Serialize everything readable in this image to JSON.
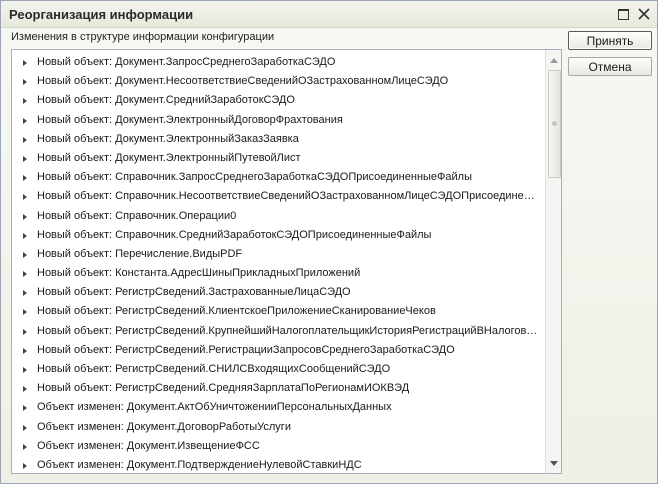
{
  "window": {
    "title": "Реорганизация информации",
    "controls": {
      "maximize_icon": "maximize-icon",
      "close_icon": "close-icon"
    }
  },
  "subtitle": "Изменения в структуре информации конфигурации",
  "buttons": {
    "accept_label": "Принять",
    "cancel_label": "Отмена"
  },
  "items": [
    "Новый объект: Документ.ЗапросСреднегоЗаработкаСЭДО",
    "Новый объект: Документ.НесоответствиеСведенийОЗастрахованномЛицеСЭДО",
    "Новый объект: Документ.СреднийЗаработокСЭДО",
    "Новый объект: Документ.ЭлектронныйДоговорФрахтования",
    "Новый объект: Документ.ЭлектронныйЗаказЗаявка",
    "Новый объект: Документ.ЭлектронныйПутевойЛист",
    "Новый объект: Справочник.ЗапросСреднегоЗаработкаСЭДОПрисоединенныеФайлы",
    "Новый объект: Справочник.НесоответствиеСведенийОЗастрахованномЛицеСЭДОПрисоединенныеФайлы",
    "Новый объект: Справочник.Операции0",
    "Новый объект: Справочник.СреднийЗаработокСЭДОПрисоединенныеФайлы",
    "Новый объект: Перечисление.ВидыPDF",
    "Новый объект: Константа.АдресШиныПрикладныхПриложений",
    "Новый объект: РегистрСведений.ЗастрахованныеЛицаСЭДО",
    "Новый объект: РегистрСведений.КлиентскоеПриложениеСканированиеЧеков",
    "Новый объект: РегистрСведений.КрупнейшийНалогоплательщикИсторияРегистрацийВНалоговомОргане",
    "Новый объект: РегистрСведений.РегистрацииЗапросовСреднегоЗаработкаСЭДО",
    "Новый объект: РегистрСведений.СНИЛСВходящихСообщенийСЭДО",
    "Новый объект: РегистрСведений.СредняяЗарплатаПоРегионамИОКВЭД",
    "Объект изменен: Документ.АктОбУничтоженииПерсональныхДанных",
    "Объект изменен: Документ.ДоговорРаботыУслуги",
    "Объект изменен: Документ.ИзвещениеФСС",
    "Объект изменен: Документ.ПодтверждениеНулевойСтавкиНДС"
  ]
}
